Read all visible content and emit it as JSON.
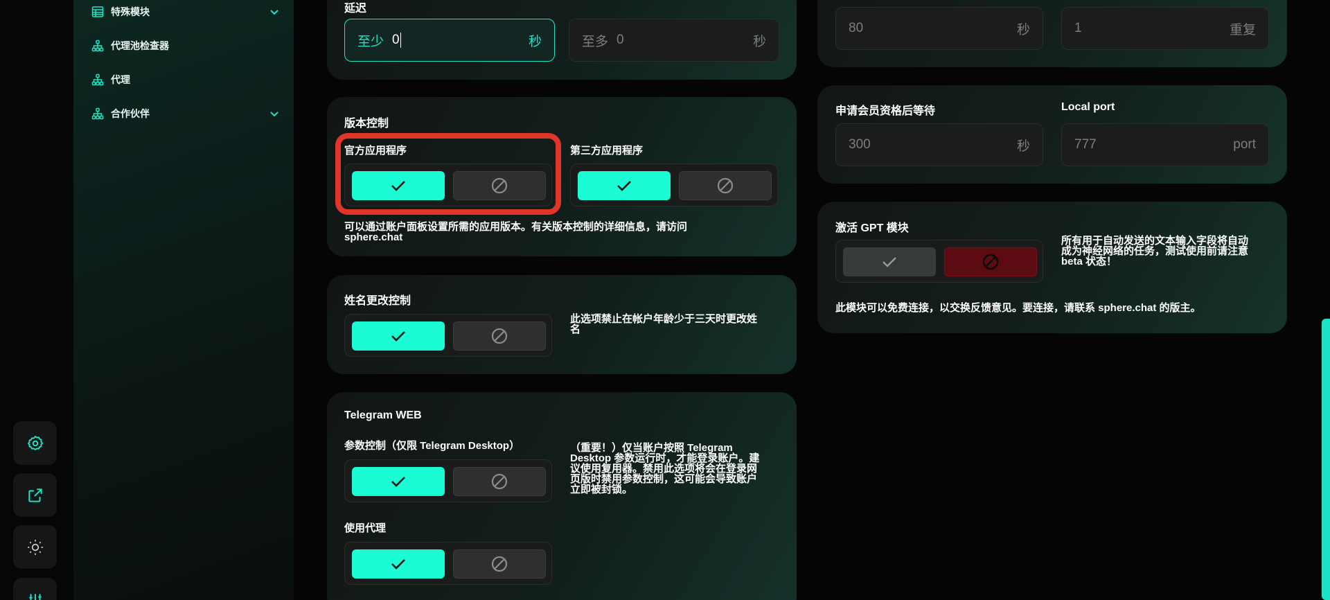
{
  "sidebar": {
    "items": [
      {
        "label": "特殊模块",
        "icon": "table-icon",
        "has_chevron": true
      },
      {
        "label": "代理池检查器",
        "icon": "hierarchy-icon",
        "has_chevron": false
      },
      {
        "label": "代理",
        "icon": "hierarchy-icon",
        "has_chevron": false
      },
      {
        "label": "合作伙伴",
        "icon": "hierarchy-icon",
        "has_chevron": true
      }
    ]
  },
  "rail": {
    "buttons": [
      "settings-icon",
      "external-link-icon",
      "theme-toggle-icon",
      "sliders-icon"
    ]
  },
  "delay": {
    "title": "延迟",
    "min_prefix": "至少",
    "min_value": "0",
    "min_unit": "秒",
    "max_prefix": "至多",
    "max_value": "0",
    "max_unit": "秒"
  },
  "top_right": {
    "field1_value": "80",
    "field1_unit": "秒",
    "field2_value": "1",
    "field2_unit": "重复"
  },
  "version_control": {
    "title": "版本控制",
    "official_label": "官方应用程序",
    "official_enabled": true,
    "third_party_label": "第三方应用程序",
    "third_party_enabled": true,
    "desc_line1": "可以通过账户面板设置所需的应用版本。有关版本控制的详细信息，请访问",
    "desc_line2": "sphere.chat"
  },
  "name_change": {
    "title": "姓名更改控制",
    "enabled": true,
    "desc_line1": "此选项禁止在帐户年龄少于三天时更改姓",
    "desc_line2": "名"
  },
  "telegram_web": {
    "title": "Telegram WEB",
    "param_label": "参数控制（仅限 Telegram Desktop）",
    "param_enabled": true,
    "proxy_label": "使用代理",
    "proxy_enabled": true,
    "desc_lines": [
      "（重要！）仅当账户按照 Telegram",
      "Desktop 参数运行时，才能登录账户。建",
      "议使用复用器。禁用此选项将会在登录网",
      "页版时禁用参数控制，这可能会导致账户",
      "立即被封锁。"
    ]
  },
  "membership": {
    "wait_label": "申请会员资格后等待",
    "wait_value": "300",
    "wait_unit": "秒",
    "port_label": "Local port",
    "port_value": "777",
    "port_unit": "port"
  },
  "gpt": {
    "title": "激活 GPT 模块",
    "enabled": false,
    "side_desc": [
      "所有用于自动发送的文本输入字段将自动",
      "成为神经网络的任务，测试使用前请注意",
      "beta 状态！"
    ],
    "bottom_desc": "此模块可以免费连接，以交换反馈意见。要连接，请联系 sphere.chat 的版主。"
  },
  "colors": {
    "accent": "#1afbd6",
    "highlight": "#e0352b",
    "disabled_red": "#5c0b12"
  }
}
